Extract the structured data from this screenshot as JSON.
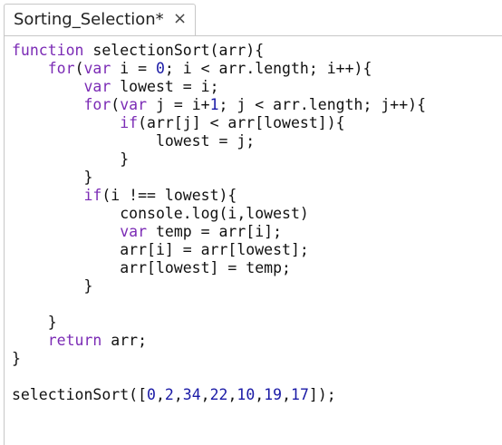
{
  "tab": {
    "title": "Sorting_Selection*",
    "close": "×"
  },
  "colors": {
    "keyword": "#7b2bb5",
    "number": "#1a1aa6",
    "text": "#111111",
    "border": "#c7c7c7"
  },
  "code": {
    "lines": [
      [
        {
          "t": "function",
          "c": "kw"
        },
        {
          "t": " selectionSort(arr){"
        }
      ],
      [
        {
          "t": "    "
        },
        {
          "t": "for",
          "c": "kw"
        },
        {
          "t": "("
        },
        {
          "t": "var",
          "c": "kw"
        },
        {
          "t": " i = "
        },
        {
          "t": "0",
          "c": "num"
        },
        {
          "t": "; i < arr.length; i++){"
        }
      ],
      [
        {
          "t": "        "
        },
        {
          "t": "var",
          "c": "kw"
        },
        {
          "t": " lowest = i;"
        }
      ],
      [
        {
          "t": "        "
        },
        {
          "t": "for",
          "c": "kw"
        },
        {
          "t": "("
        },
        {
          "t": "var",
          "c": "kw"
        },
        {
          "t": " j = i+"
        },
        {
          "t": "1",
          "c": "num"
        },
        {
          "t": "; j < arr.length; j++){"
        }
      ],
      [
        {
          "t": "            "
        },
        {
          "t": "if",
          "c": "kw"
        },
        {
          "t": "(arr[j] < arr[lowest]){"
        }
      ],
      [
        {
          "t": "                lowest = j;"
        }
      ],
      [
        {
          "t": "            }"
        }
      ],
      [
        {
          "t": "        }"
        }
      ],
      [
        {
          "t": "        "
        },
        {
          "t": "if",
          "c": "kw"
        },
        {
          "t": "(i !== lowest){"
        }
      ],
      [
        {
          "t": "            console.log(i,lowest)"
        }
      ],
      [
        {
          "t": "            "
        },
        {
          "t": "var",
          "c": "kw"
        },
        {
          "t": " temp = arr[i];"
        }
      ],
      [
        {
          "t": "            arr[i] = arr[lowest];"
        }
      ],
      [
        {
          "t": "            arr[lowest] = temp;"
        }
      ],
      [
        {
          "t": "        }"
        }
      ],
      [
        {
          "t": ""
        }
      ],
      [
        {
          "t": "    }"
        }
      ],
      [
        {
          "t": "    "
        },
        {
          "t": "return",
          "c": "kw"
        },
        {
          "t": " arr;"
        }
      ],
      [
        {
          "t": "}"
        }
      ],
      [
        {
          "t": ""
        }
      ],
      [
        {
          "t": "selectionSort(["
        },
        {
          "t": "0",
          "c": "num"
        },
        {
          "t": ","
        },
        {
          "t": "2",
          "c": "num"
        },
        {
          "t": ","
        },
        {
          "t": "34",
          "c": "num"
        },
        {
          "t": ","
        },
        {
          "t": "22",
          "c": "num"
        },
        {
          "t": ","
        },
        {
          "t": "10",
          "c": "num"
        },
        {
          "t": ","
        },
        {
          "t": "19",
          "c": "num"
        },
        {
          "t": ","
        },
        {
          "t": "17",
          "c": "num"
        },
        {
          "t": "]);"
        }
      ]
    ]
  }
}
